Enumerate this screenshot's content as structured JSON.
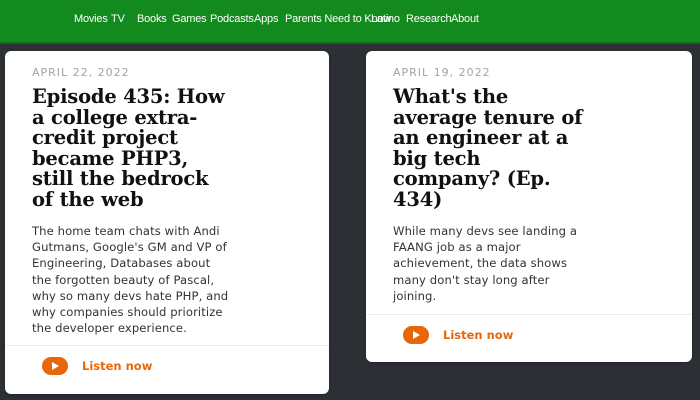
{
  "nav": {
    "items": [
      "Movies",
      "TV",
      "Books",
      "Games",
      "Podcasts",
      "Apps",
      "Parents Need to Know",
      "Latino",
      "Research",
      "About"
    ]
  },
  "cards": [
    {
      "date": "APRIL 22, 2022",
      "title_lines": [
        "Episode 435: How",
        "a college extra-",
        "credit project",
        "became PHP3,",
        "still the bedrock",
        "of the web"
      ],
      "description_lines": [
        "The home team chats with Andi",
        "Gutmans, Google's GM and VP of",
        "Engineering, Databases about",
        "the forgotten beauty of Pascal,",
        "why so many devs hate PHP, and",
        "why companies should prioritize",
        "the developer experience."
      ],
      "cta": "Listen now"
    },
    {
      "date": "APRIL 19, 2022",
      "title_lines": [
        "What's the",
        "average tenure of",
        "an engineer at a",
        "big tech",
        "company? (Ep.",
        "434)"
      ],
      "description_lines": [
        "While many devs see landing a",
        "FAANG job as a major",
        "achievement, the data shows",
        "many don't stay long after",
        "joining."
      ],
      "cta": "Listen now"
    }
  ],
  "colors": {
    "nav_bg": "#138a1d",
    "page_bg": "#2c2f33",
    "accent": "#e8660c"
  }
}
